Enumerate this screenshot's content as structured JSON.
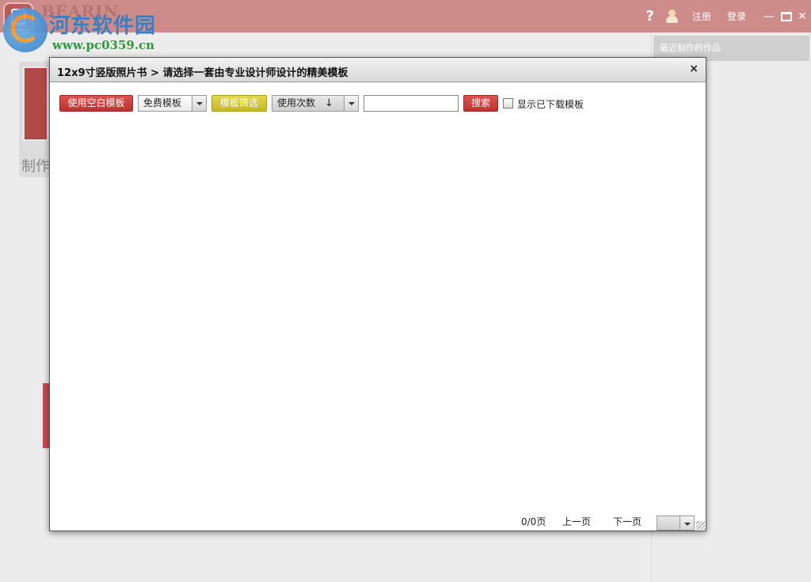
{
  "app": {
    "brand": "BEARIN",
    "watermark_title": "河东软件园",
    "watermark_url": "www.pc0359.cn",
    "help": "?",
    "register": "注册",
    "login": "登录",
    "minimize": "—",
    "close": "✕"
  },
  "right_panel": {
    "title": "最近制作的作品"
  },
  "background": {
    "card_label": "制作"
  },
  "dialog": {
    "title": "12x9寸竖版照片书 > 请选择一套由专业设计师设计的精美模板",
    "close": "×",
    "toolbar": {
      "blank_template": "使用空白模板",
      "template_type": "免费模板",
      "filter": "模板筛选",
      "sort_by": "使用次数",
      "sort_dir": "↓",
      "search_value": "",
      "search": "搜索",
      "show_downloaded": "显示已下载模板",
      "show_downloaded_checked": false
    },
    "pager": {
      "page_status": "0/0页",
      "prev": "上一页",
      "next": "下一页",
      "page_select": ""
    }
  },
  "colors": {
    "titlebar": "#cd8c8a",
    "red_button": "#c9403c",
    "yellow_button": "#d3c837"
  }
}
